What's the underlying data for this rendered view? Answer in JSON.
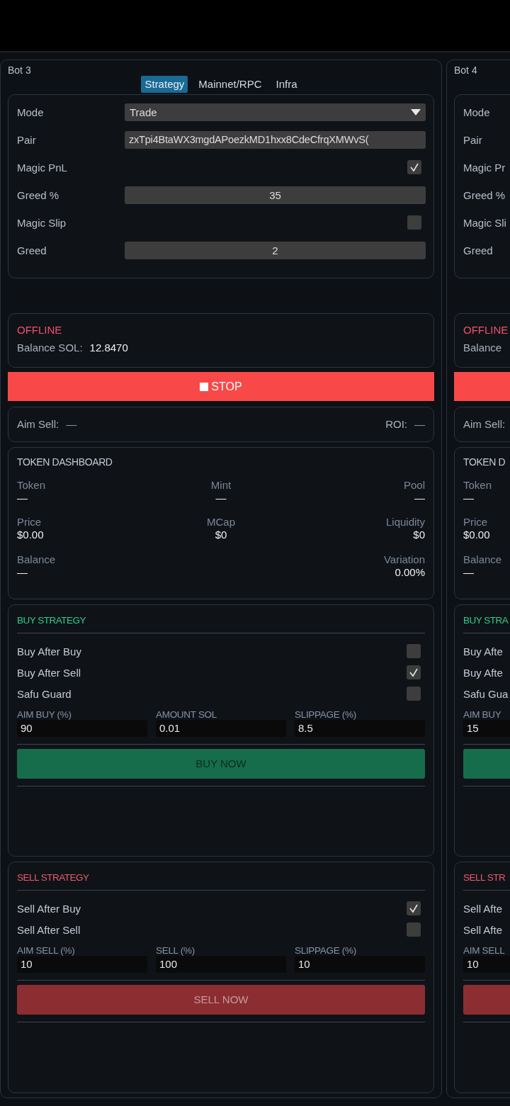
{
  "bots": [
    {
      "title": "Bot 3",
      "tabs": [
        {
          "label": "Strategy",
          "selected": true
        },
        {
          "label": "Mainnet/RPC",
          "selected": false
        },
        {
          "label": "Infra",
          "selected": false
        }
      ],
      "settings": [
        {
          "kind": "select",
          "label": "Mode",
          "value": "Trade"
        },
        {
          "kind": "text",
          "label": "Pair",
          "value": "zxTpi4BtaWX3mgdAPoezkMD1hxx8CdeCfrqXMWvS("
        },
        {
          "kind": "checkbox",
          "label": "Magic PnL",
          "checked": true
        },
        {
          "kind": "number",
          "label": "Greed %",
          "value": "35"
        },
        {
          "kind": "checkbox",
          "label": "Magic Slip",
          "checked": false
        },
        {
          "kind": "number",
          "label": "Greed",
          "value": "2"
        }
      ],
      "status": {
        "state": "OFFLINE",
        "balance_label": "Balance SOL:",
        "balance_value": "12.8470"
      },
      "stop_button": {
        "label": "STOP"
      },
      "aim": {
        "aim_sell_label": "Aim Sell:",
        "aim_sell_value": "—",
        "roi_label": "ROI:",
        "roi_value": "—"
      },
      "dashboard": {
        "title": "TOKEN DASHBOARD",
        "rows": [
          {
            "left": {
              "label": "Token",
              "value": "—"
            },
            "center": {
              "label": "Mint",
              "value": "—"
            },
            "right": {
              "label": "Pool",
              "value": "—"
            }
          },
          {
            "left": {
              "label": "Price",
              "value": "$0.00"
            },
            "center": {
              "label": "MCap",
              "value": "$0"
            },
            "right": {
              "label": "Liquidity",
              "value": "$0"
            }
          },
          {
            "left": {
              "label": "Balance",
              "value": "—"
            },
            "right": {
              "label": "Variation",
              "value": "0.00%"
            }
          }
        ]
      },
      "buy": {
        "title": "BUY STRATEGY",
        "toggles": [
          {
            "label": "Buy After Buy",
            "checked": false
          },
          {
            "label": "Buy After Sell",
            "checked": true
          },
          {
            "label": "Safu Guard",
            "checked": false
          }
        ],
        "fields": [
          {
            "label": "AIM BUY (%)",
            "value": "90"
          },
          {
            "label": "AMOUNT SOL",
            "value": "0.01"
          },
          {
            "label": "SLIPPAGE (%)",
            "value": "8.5"
          }
        ],
        "button": "BUY NOW"
      },
      "sell": {
        "title": "SELL STRATEGY",
        "toggles": [
          {
            "label": "Sell After Buy",
            "checked": true
          },
          {
            "label": "Sell After Sell",
            "checked": false
          }
        ],
        "fields": [
          {
            "label": "AIM SELL (%)",
            "value": "10"
          },
          {
            "label": "SELL (%)",
            "value": "100"
          },
          {
            "label": "SLIPPAGE (%)",
            "value": "10"
          }
        ],
        "button": "SELL NOW"
      }
    },
    {
      "title": "Bot 4",
      "settings": [
        {
          "label": "Mode"
        },
        {
          "label": "Pair"
        },
        {
          "label": "Magic Pr"
        },
        {
          "label": "Greed %"
        },
        {
          "label": "Magic Sli"
        },
        {
          "label": "Greed"
        }
      ],
      "status": {
        "state": "OFFLINE",
        "balance_label": "Balance"
      },
      "aim": {
        "aim_sell_label": "Aim Sell:"
      },
      "dashboard": {
        "title": "TOKEN D",
        "rows": [
          {
            "left": {
              "label": "Token",
              "value": "—"
            }
          },
          {
            "left": {
              "label": "Price",
              "value": "$0.00"
            }
          },
          {
            "left": {
              "label": "Balance",
              "value": "—"
            }
          }
        ]
      },
      "buy": {
        "title": "BUY STRA",
        "toggles": [
          {
            "label": "Buy Afte"
          },
          {
            "label": "Buy Afte"
          },
          {
            "label": "Safu Gua"
          }
        ],
        "fields": [
          {
            "label": "AIM BUY",
            "value": "15"
          }
        ]
      },
      "sell": {
        "title": "SELL STR",
        "toggles": [
          {
            "label": "Sell Afte"
          },
          {
            "label": "Sell Afte"
          }
        ],
        "fields": [
          {
            "label": "AIM SELL",
            "value": "10"
          }
        ]
      }
    }
  ]
}
